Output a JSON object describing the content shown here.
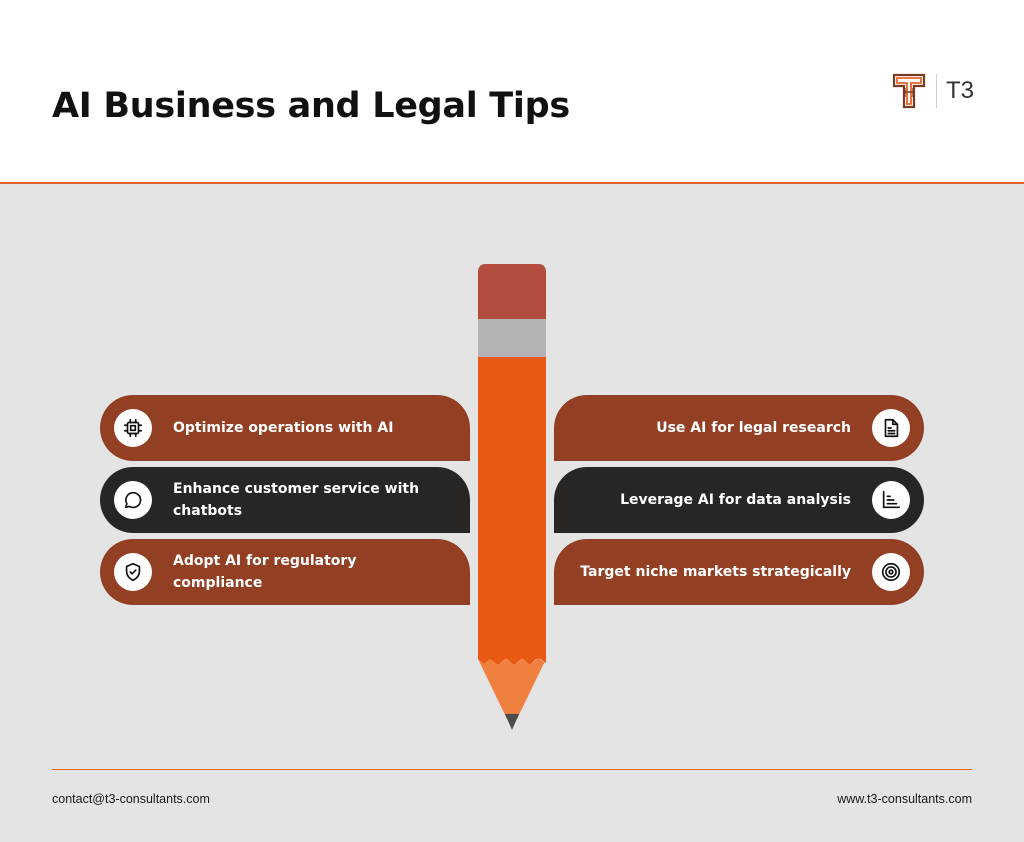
{
  "header": {
    "title": "AI Business and Legal Tips",
    "logo_text": "T3"
  },
  "colors": {
    "accent": "#e8652a",
    "card_brown": "#923f24",
    "card_dark": "#272624",
    "pencil_eraser": "#b24c3f",
    "pencil_ferrule": "#b3b3b3",
    "pencil_body": "#e85a14",
    "pencil_wood": "#f08040",
    "pencil_lead": "#4a4a4a",
    "background": "#e4e4e4"
  },
  "tips": {
    "left": [
      {
        "label": "Optimize operations with AI",
        "icon": "cpu-chip-icon",
        "style": "brown"
      },
      {
        "label": "Enhance customer service with chatbots",
        "icon": "chat-bubble-icon",
        "style": "dark"
      },
      {
        "label": "Adopt AI for regulatory compliance",
        "icon": "shield-check-icon",
        "style": "brown"
      }
    ],
    "right": [
      {
        "label": "Use AI for legal research",
        "icon": "document-icon",
        "style": "brown"
      },
      {
        "label": "Leverage AI for data analysis",
        "icon": "bar-chart-icon",
        "style": "dark"
      },
      {
        "label": "Target niche markets strategically",
        "icon": "target-icon",
        "style": "brown"
      }
    ]
  },
  "footer": {
    "email": "contact@t3-consultants.com",
    "website": "www.t3-consultants.com"
  }
}
